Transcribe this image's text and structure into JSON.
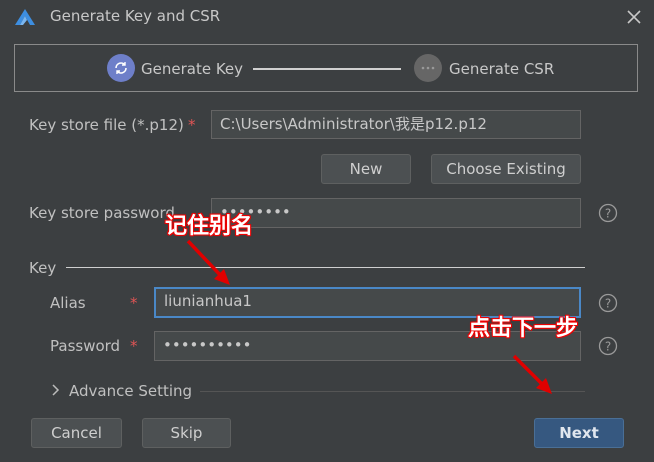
{
  "window": {
    "title": "Generate Key and CSR",
    "close_icon": "close-icon",
    "logo_icon": "app-logo-icon"
  },
  "steps": [
    {
      "label": "Generate Key",
      "state": "active",
      "icon": "refresh-icon"
    },
    {
      "label": "Generate CSR",
      "state": "pending",
      "icon": "ellipsis-icon"
    }
  ],
  "keystore": {
    "file_label": "Key store file (*.p12)",
    "file_value": "C:\\Users\\Administrator\\我是p12.p12",
    "new_button": "New",
    "choose_button": "Choose Existing",
    "password_label": "Key store password",
    "password_value": "••••••••"
  },
  "key": {
    "section_label": "Key",
    "alias_label": "Alias",
    "alias_value": "liunianhua1",
    "password_label": "Password",
    "password_value": "••••••••••"
  },
  "advanced": {
    "label": "Advance Setting"
  },
  "footer": {
    "cancel": "Cancel",
    "skip": "Skip",
    "next": "Next"
  },
  "required_mark": "*",
  "annotations": {
    "remember_alias": "记住别名",
    "click_next": "点击下一步"
  },
  "colors": {
    "background": "#3c3f41",
    "accent": "#4a88c7",
    "primary_button": "#365880",
    "required": "#e05555",
    "annotation": "#e00000"
  }
}
